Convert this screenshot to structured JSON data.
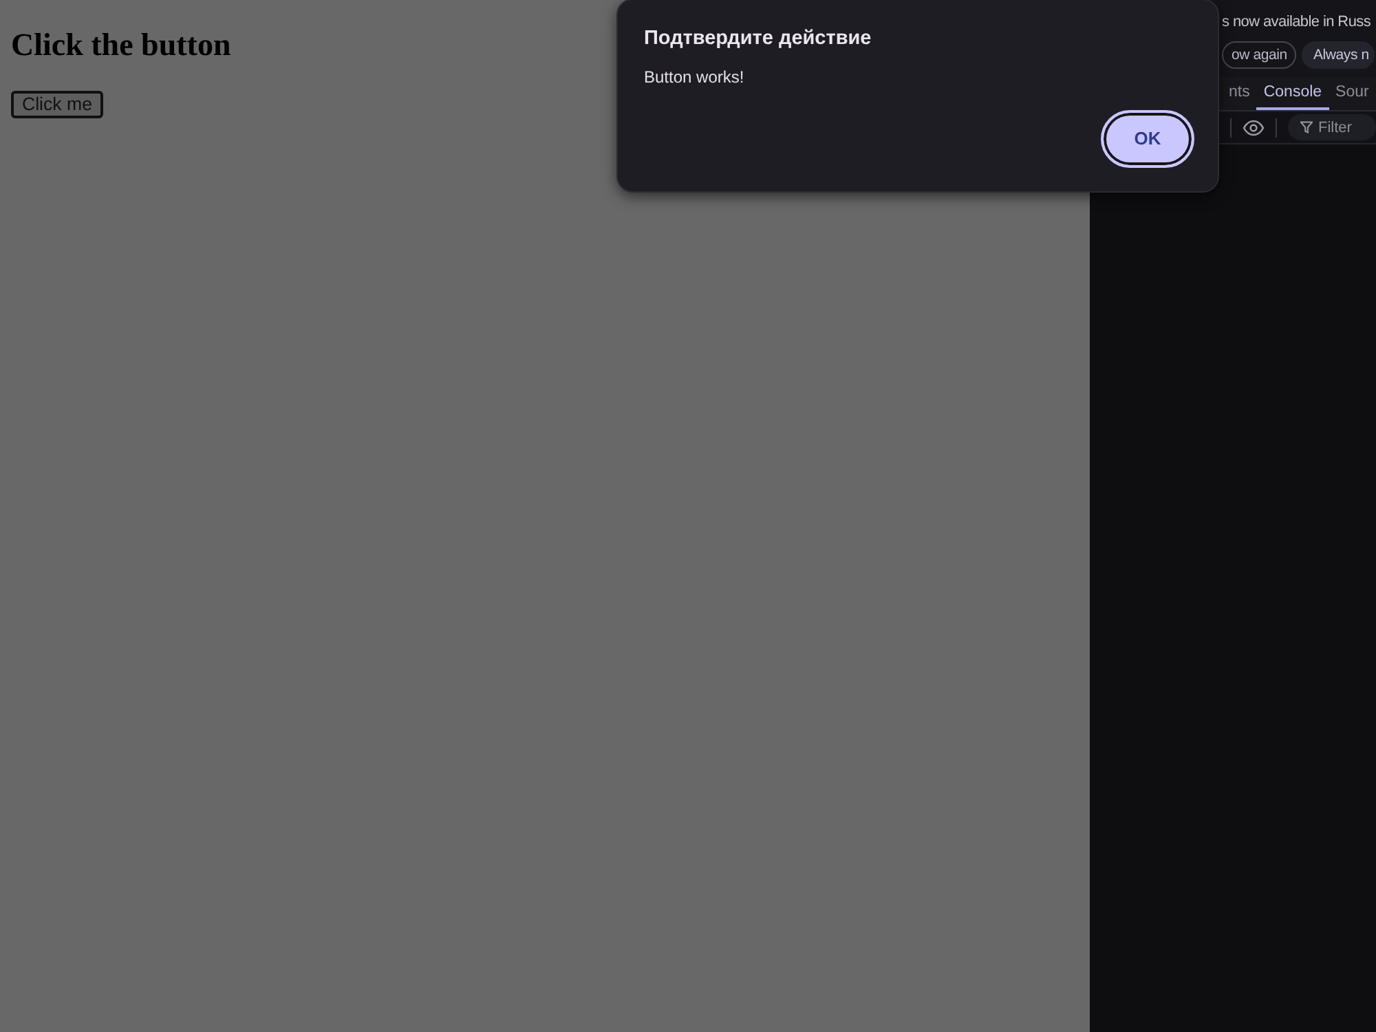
{
  "page": {
    "heading": "Click the button",
    "button": "Click me"
  },
  "devtools": {
    "infobar": {
      "text": "s now available in Russ",
      "buttons": [
        {
          "label": "ow again",
          "kind": "outline"
        },
        {
          "label": "Always n",
          "kind": "filled"
        }
      ]
    },
    "tabs": [
      {
        "label": "nts",
        "selected": false
      },
      {
        "label": "Console",
        "selected": true
      },
      {
        "label": "Sour",
        "selected": false
      }
    ],
    "filter": {
      "placeholder": "Filter"
    }
  },
  "dialog": {
    "title": "Подтвердите действие",
    "message": "Button works!",
    "buttons": [
      {
        "label": "OK",
        "focused": true
      }
    ]
  }
}
